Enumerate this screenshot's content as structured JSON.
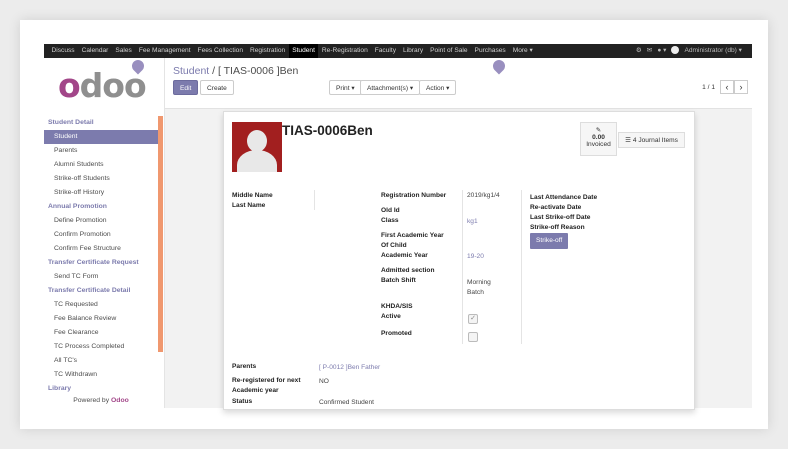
{
  "topbar": {
    "menu": [
      "Discuss",
      "Calendar",
      "Sales",
      "Fee Management",
      "Fees Collection",
      "Registration",
      "Student",
      "Re-Registration",
      "Faculty",
      "Library",
      "Point of Sale",
      "Purchases",
      "More ▾"
    ],
    "active": "Student",
    "user": "Administrator (db) ▾"
  },
  "logo": "odoo",
  "sidebar": {
    "sections": [
      {
        "header": "Student Detail",
        "items": [
          "Student",
          "Parents",
          "Alumni Students",
          "Strike-off Students",
          "Strike-off History"
        ]
      },
      {
        "header": "Annual Promotion",
        "items": [
          "Define Promotion",
          "Confirm Promotion",
          "Confirm Fee Structure"
        ]
      },
      {
        "header": "Transfer Certificate Request",
        "items": [
          "Send TC Form"
        ]
      },
      {
        "header": "Transfer Certificate Detail",
        "items": [
          "TC Requested",
          "Fee Balance Review",
          "Fee Clearance",
          "TC Process Completed",
          "All TC's",
          "TC Withdrawn"
        ]
      },
      {
        "header": "Library",
        "items": []
      }
    ],
    "selected": "Student",
    "powered_prefix": "Powered by",
    "powered_brand": "Odoo"
  },
  "control_panel": {
    "breadcrumb_link": "Student",
    "breadcrumb_sep": "/",
    "breadcrumb_current": "[ TIAS-0006 ]Ben",
    "edit_label": "Edit",
    "create_label": "Create",
    "print_label": "Print ▾",
    "attachments_label": "Attachment(s) ▾",
    "action_label": "Action ▾",
    "pager": "1 / 1",
    "prev": "‹",
    "next": "›"
  },
  "form": {
    "title": "TIAS-0006Ben",
    "invoiced_value": "0.00",
    "invoiced_label": "Invoiced",
    "journal_label": "4 Journal Items",
    "left_labels": {
      "middle_name": "Middle Name",
      "last_name": "Last Name"
    },
    "mid": {
      "registration_number_label": "Registration Number",
      "registration_number": "2019/kg1/4",
      "old_id_label": "Old Id",
      "class_label": "Class",
      "class_value": "kg1",
      "first_year_label_1": "First Academic Year",
      "first_year_label_2": "Of Child",
      "academic_year_label": "Academic Year",
      "academic_year": "19-20",
      "admitted_section_label": "Admitted section",
      "batch_shift_label": "Batch Shift",
      "batch_shift_1": "Morning",
      "batch_shift_2": "Batch",
      "khda_label": "KHDA/SIS",
      "active_label": "Active",
      "promoted_label": "Promoted"
    },
    "right_labels": {
      "last_attendance": "Last Attendance Date",
      "reactivate": "Re-activate Date",
      "last_strike": "Last Strike-off Date",
      "strike_reason": "Strike-off Reason"
    },
    "strike_off_button": "Strike-off",
    "bottom": {
      "parents_label": "Parents",
      "parents_value": "[ P-0012 ]Ben Father",
      "rereg_label_1": "Re-registered for next",
      "rereg_label_2": "Academic year",
      "rereg_value": "NO",
      "status_label": "Status",
      "status_value": "Confirmed Student"
    },
    "active_checked": true,
    "promoted_checked": false
  },
  "colors": {
    "accent": "#7c7bad",
    "brand": "#a24689",
    "sidebar_strip": "#f0986f",
    "photo_bg": "#a21f1f"
  }
}
